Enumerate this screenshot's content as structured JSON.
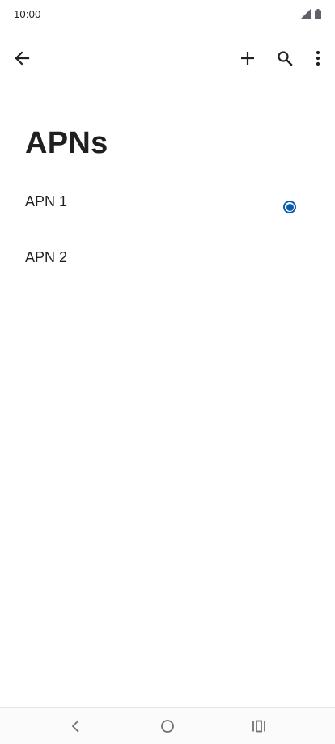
{
  "status_bar": {
    "time": "10:00"
  },
  "app_bar": {
    "icons": [
      "back-arrow-icon",
      "plus-icon",
      "search-icon",
      "more-vert-icon"
    ]
  },
  "page": {
    "title": "APNs"
  },
  "apns": [
    {
      "name": "APN 1",
      "selected": true
    },
    {
      "name": "APN 2",
      "selected": false
    }
  ],
  "nav_bar": {
    "icons": [
      "nav-back-icon",
      "nav-home-icon",
      "nav-recents-icon"
    ]
  },
  "colors": {
    "accent": "#0b5cad",
    "text": "#1f1f1f",
    "background": "#ffffff"
  }
}
